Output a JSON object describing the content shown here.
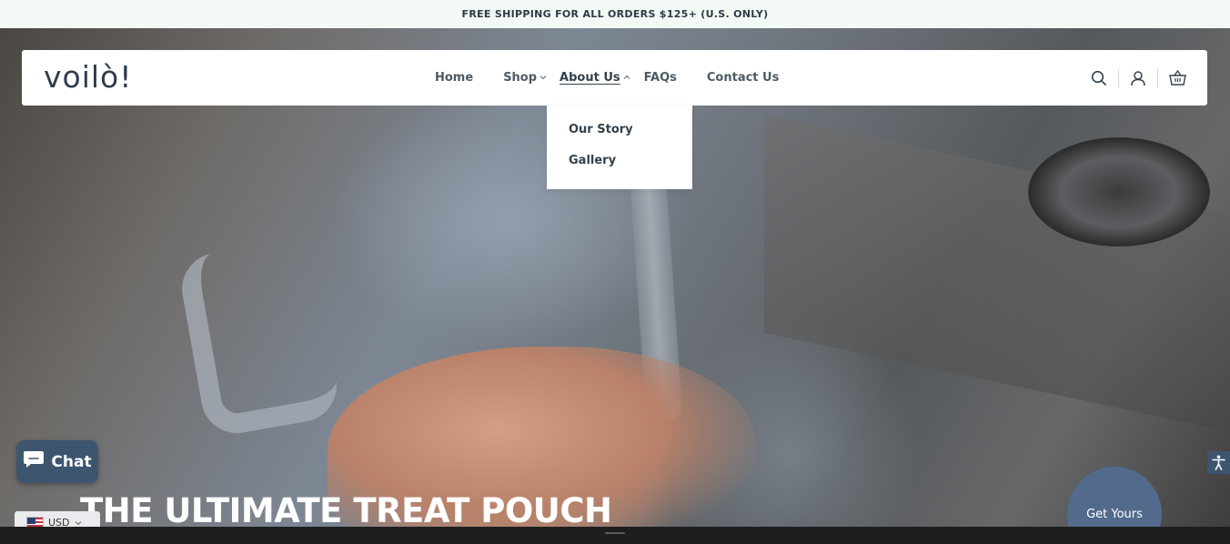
{
  "announcement": {
    "text": "FREE SHIPPING FOR ALL ORDERS $125+ (U.S. ONLY)"
  },
  "header": {
    "logo_text": "voilò!",
    "nav": {
      "home": "Home",
      "shop": "Shop",
      "about": "About Us",
      "faqs": "FAQs",
      "contact": "Contact Us"
    },
    "icons": [
      "search-icon",
      "account-icon",
      "cart-icon"
    ]
  },
  "about_dropdown": {
    "items": [
      "Our Story",
      "Gallery"
    ]
  },
  "hero": {
    "title": "THE ULTIMATE TREAT POUCH",
    "cta_label": "Get Yours"
  },
  "chat": {
    "label": "Chat"
  },
  "currency": {
    "label": "USD",
    "flag": "us-flag-icon"
  },
  "colors": {
    "announcement_bg": "#f3faf6",
    "nav_text": "#4d5a66",
    "accent": "#526b8c",
    "chat_bg": "#3e5570"
  }
}
